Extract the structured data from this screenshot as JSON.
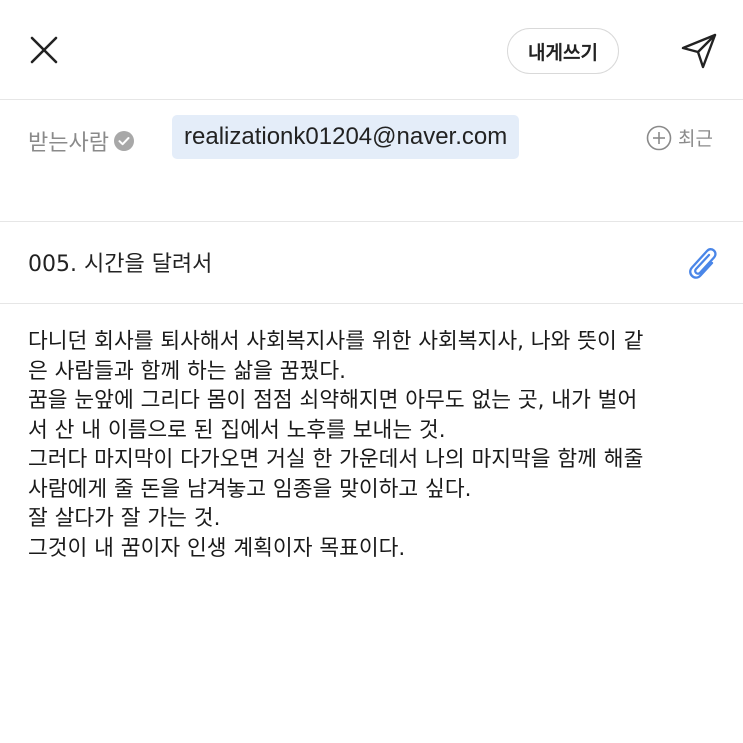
{
  "toolbar": {
    "close_icon": "close-icon",
    "send_to_self_label": "내게쓰기",
    "send_icon": "paper-plane-icon"
  },
  "recipient": {
    "label": "받는사람",
    "verified_icon": "check-circle-icon",
    "address": "realizationk01204@naver.com",
    "recent_label": "최근",
    "recent_icon": "plus-circle-icon"
  },
  "subject": {
    "text": "005. 시간을 달려서",
    "attach_icon": "paperclip-icon"
  },
  "body": {
    "lines": [
      "다니던 회사를 퇴사해서 사회복지사를 위한 사회복지사, 나와 뜻이 같",
      "은 사람들과 함께 하는 삶을 꿈꿨다.",
      "꿈을 눈앞에 그리다 몸이 점점 쇠약해지면 아무도 없는 곳, 내가 벌어",
      "서 산 내 이름으로 된 집에서 노후를 보내는 것.",
      "그러다 마지막이 다가오면 거실 한 가운데서 나의 마지막을 함께 해줄",
      "사람에게 줄 돈을 남겨놓고 임종을 맞이하고 싶다.",
      "잘 살다가 잘 가는 것.",
      "그것이 내 꿈이자 인생 계획이자 목표이다."
    ]
  },
  "colors": {
    "chip_background": "#e4edf9",
    "accent_blue": "#4a86e8",
    "muted_gray": "#8a8a8a",
    "divider": "#e6e6e6"
  }
}
